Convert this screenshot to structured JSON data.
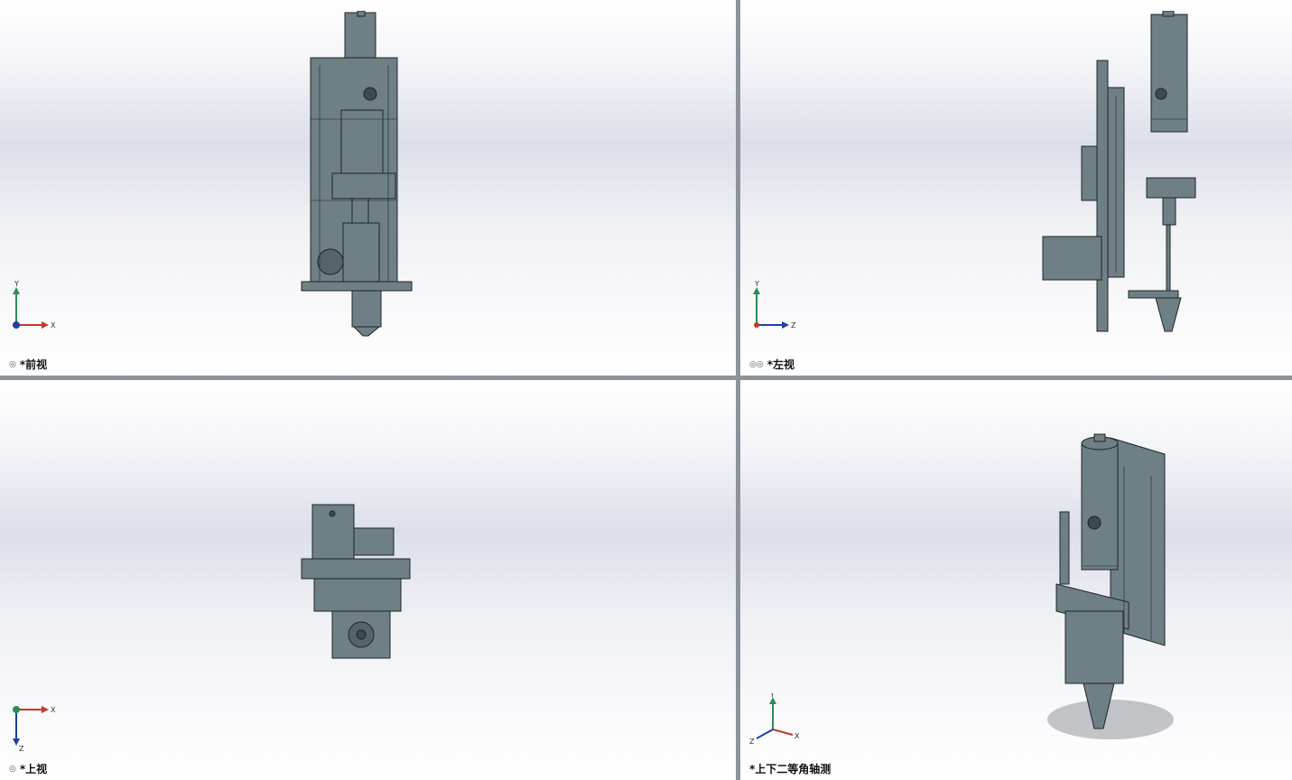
{
  "viewports": [
    {
      "id": "front",
      "label": "*前视",
      "icon": "view-link-icon",
      "axes": {
        "up": "Y",
        "right": "X"
      }
    },
    {
      "id": "left",
      "label": "*左视",
      "icon": "view-link-icon",
      "axes": {
        "up": "Y",
        "right": "Z"
      }
    },
    {
      "id": "top",
      "label": "*上视",
      "icon": "view-link-icon",
      "axes": {
        "up": "Z",
        "right": "X"
      }
    },
    {
      "id": "iso",
      "label": "*上下二等角轴测",
      "icon": "",
      "axes": {
        "up": "Y",
        "right": "X",
        "diag": "Z"
      }
    }
  ],
  "colors": {
    "part": "#6e7f85",
    "part_dark": "#3d4a4f",
    "edge": "#1f2629",
    "background_mid": "#dcdfe9"
  }
}
